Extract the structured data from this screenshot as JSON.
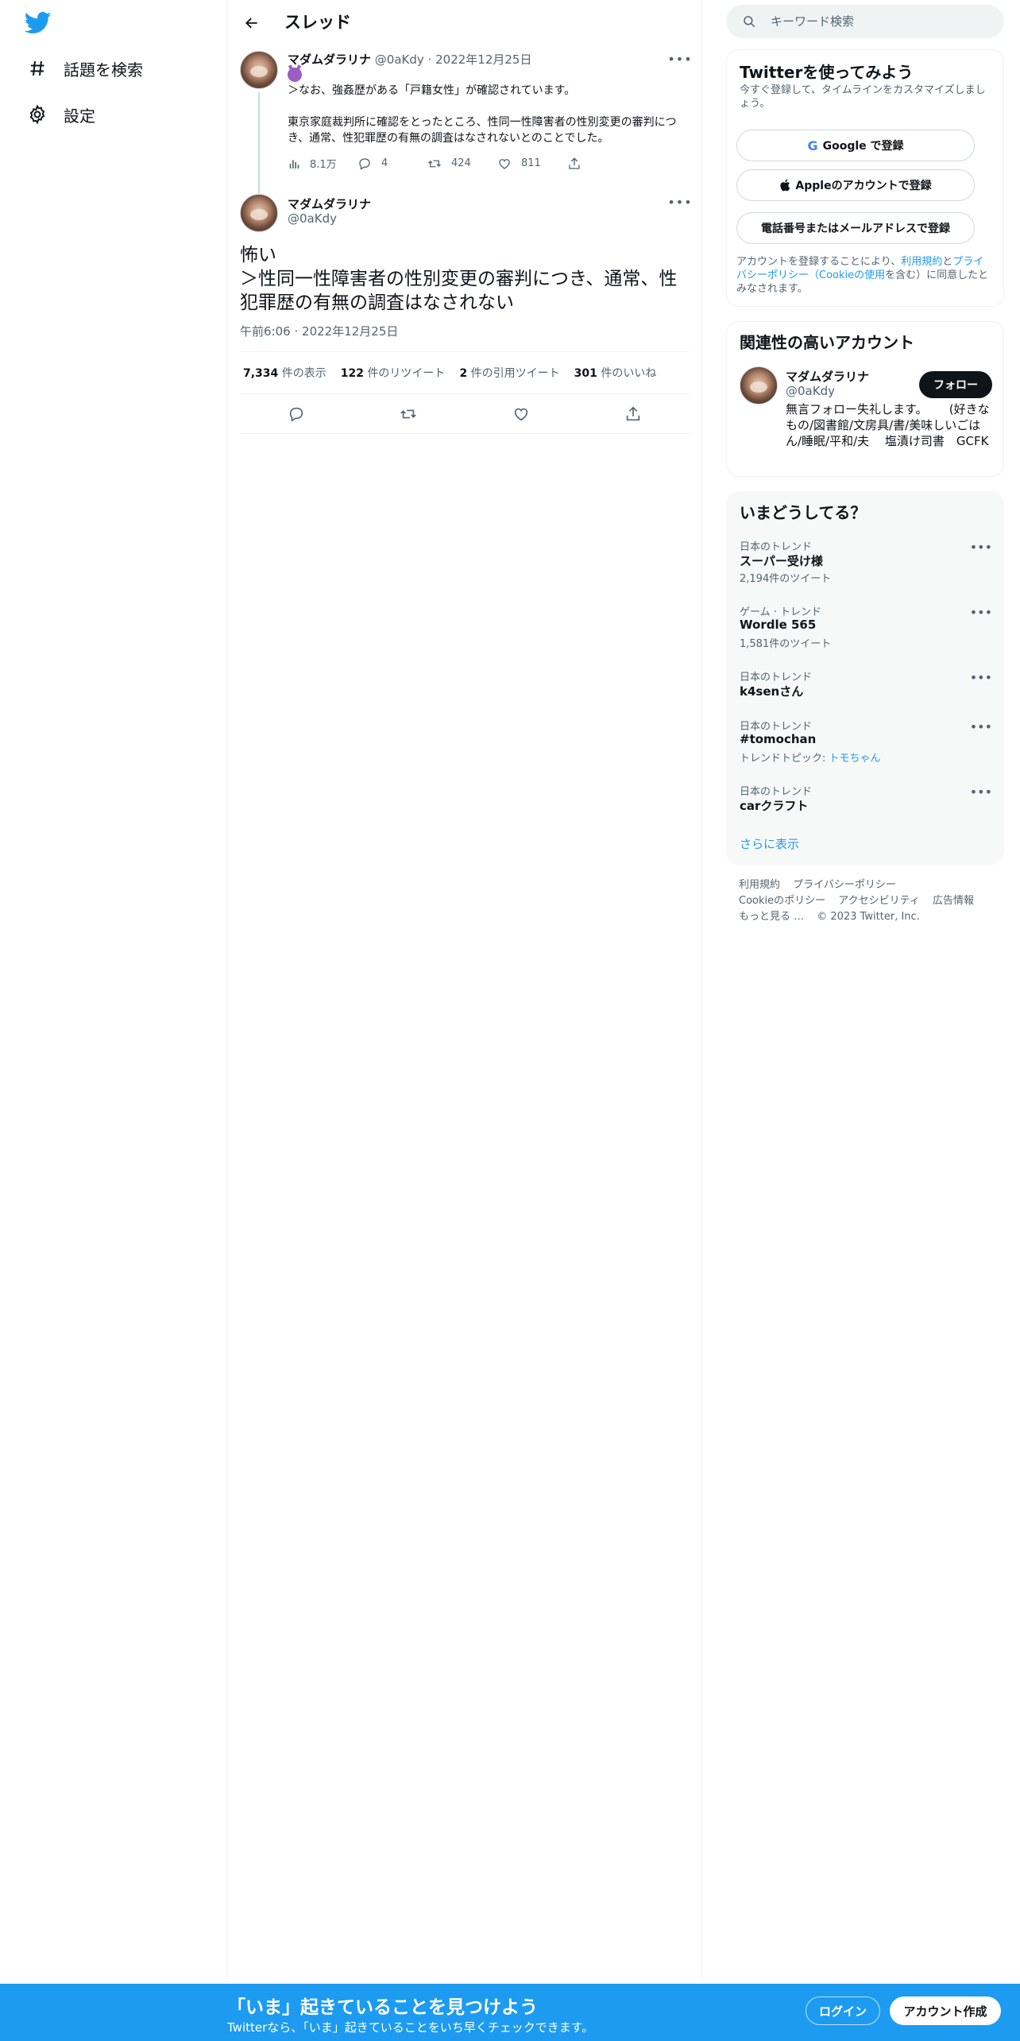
{
  "colors": {
    "accent": "#1d9bf0",
    "text": "#0f1419",
    "muted": "#536471",
    "border": "#eff3f4"
  },
  "nav": {
    "logo_icon": "twitter-bird-icon",
    "items": [
      {
        "icon": "hashtag-icon",
        "label": "話題を検索"
      },
      {
        "icon": "gear-icon",
        "label": "設定"
      }
    ]
  },
  "header": {
    "back_icon": "arrow-left-icon",
    "title": "スレッド"
  },
  "tweet1": {
    "name": "マダムダラリナ",
    "handle": "@0aKdy",
    "separator": "·",
    "date": "2022年12月25日",
    "more_icon": "more-icon",
    "emoji_icon": "smiling-devil-icon",
    "line1": "＞なお、強姦歴がある「戸籍女性」が確認されています。",
    "line2": "東京家庭裁判所に確認をとったところ、性同一性障害者の性別変更の審判につき、通常、性犯罪歴の有無の調査はなされないとのことでした。",
    "actions": {
      "views": "8.1万",
      "replies": "4",
      "retweets": "424",
      "likes": "811"
    }
  },
  "tweet2": {
    "name": "マダムダラリナ",
    "handle": "@0aKdy",
    "text_line1": "怖い",
    "text_line2": "＞性同一性障害者の性別変更の審判につき、通常、性犯罪歴の有無の調査はなされない",
    "time": "午前6:06",
    "separator": "·",
    "date": "2022年12月25日",
    "stats": [
      {
        "num": "7,334",
        "unit": "件の表示"
      },
      {
        "num": "122",
        "unit": "件のリツイート"
      },
      {
        "num": "2",
        "unit": "件の引用ツイート"
      },
      {
        "num": "301",
        "unit": "件のいいね"
      }
    ]
  },
  "search": {
    "placeholder": "キーワード検索"
  },
  "signup": {
    "title": "Twitterを使ってみよう",
    "subtitle": "今すぐ登録して、タイムラインをカスタマイズしましょう。",
    "google_label": "Google で登録",
    "apple_label": "Appleのアカウントで登録",
    "phone_label": "電話番号またはメールアドレスで登録",
    "legal_pre": "アカウントを登録することにより、",
    "legal_terms": "利用規約",
    "legal_and": "と",
    "legal_privacy": "プライバシーポリシー",
    "legal_paren_open": "（",
    "legal_cookie": "Cookieの使用",
    "legal_post": "を含む）に同意したとみなされます。"
  },
  "relevant": {
    "title": "関連性の高いアカウント",
    "name": "マダムダラリナ",
    "handle": "@0aKdy",
    "follow_label": "フォロー",
    "bio": "無言フォロー失礼します。　　 (好きなもの/図書館/文房具/書/美味しいごはん/睡眠/平和/夫　 塩漬け司書　GCFK"
  },
  "trends": {
    "title": "いまどうしてる？",
    "items": [
      {
        "category": "日本のトレンド",
        "name": "スーパー受け様",
        "count": "2,194件のツイート"
      },
      {
        "category": "ゲーム · トレンド",
        "name": "Wordle 565",
        "count": "1,581件のツイート"
      },
      {
        "category": "日本のトレンド",
        "name": "k4senさん",
        "count": ""
      },
      {
        "category": "日本のトレンド",
        "name": "#tomochan",
        "count_prefix": "トレンドトピック: ",
        "count_link": "トモちゃん"
      },
      {
        "category": "日本のトレンド",
        "name": "carクラフト",
        "count": ""
      }
    ],
    "show_more": "さらに表示"
  },
  "footer": {
    "terms": "利用規約",
    "privacy": "プライバシーポリシー",
    "cookie": "Cookieのポリシー",
    "accessibility": "アクセシビリティ",
    "ads": "広告情報",
    "more": "もっと見る …",
    "copyright": "© 2023 Twitter, Inc."
  },
  "banner": {
    "title": "「いま」起きていることを見つけよう",
    "subtitle": "Twitterなら、「いま」起きていることをいち早くチェックできます。",
    "login_label": "ログイン",
    "signup_label": "アカウント作成"
  }
}
